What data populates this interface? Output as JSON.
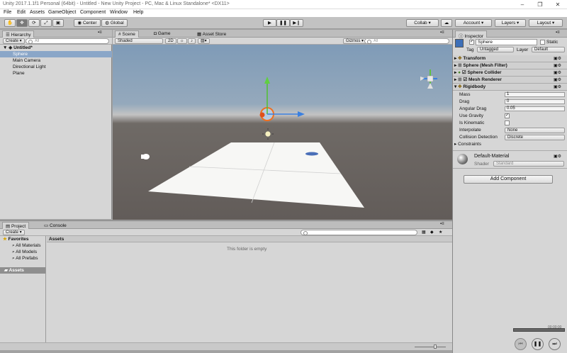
{
  "window": {
    "title": "Unity 2017.1.1f1 Personal (64bit) - Untitled - New Unity Project - PC, Mac & Linux Standalone* <DX11>",
    "min": "–",
    "max": "❐",
    "close": "✕"
  },
  "menu": [
    "File",
    "Edit",
    "Assets",
    "GameObject",
    "Component",
    "Window",
    "Help"
  ],
  "toolbar": {
    "center": "Center",
    "global": "Global",
    "collab": "Collab ▾",
    "account": "Account ▾",
    "layers": "Layers ▾",
    "layout": "Layout ▾",
    "play": "▶",
    "pause": "❚❚",
    "step": "▶❙"
  },
  "hierarchy": {
    "tab": "Hierarchy",
    "create": "Create ▾",
    "search": "All",
    "scene": "Untitled*",
    "items": [
      "Sphere",
      "Main Camera",
      "Directional Light",
      "Plane"
    ]
  },
  "scene": {
    "tabs": [
      "Scene",
      "Game",
      "Asset Store"
    ],
    "shading": "Shaded",
    "mode2d": "2D",
    "gizmos": "Gizmos ▾",
    "search": "All"
  },
  "project": {
    "tabs": [
      "Project",
      "Console"
    ],
    "create": "Create ▾",
    "favorites": "Favorites",
    "fav_items": [
      "All Materials",
      "All Models",
      "All Prefabs"
    ],
    "assets_root": "Assets",
    "crumb": "Assets",
    "empty": "This folder is empty"
  },
  "inspector": {
    "tab": "Inspector",
    "object_name": "Sphere",
    "static": "Static",
    "tag_label": "Tag",
    "tag": "Untagged",
    "layer_label": "Layer",
    "layer": "Default",
    "components": [
      "Transform",
      "Sphere (Mesh Filter)",
      "Sphere Collider",
      "Mesh Renderer",
      "Rigidbody"
    ],
    "props": [
      {
        "label": "Mass",
        "value": "1"
      },
      {
        "label": "Drag",
        "value": "0"
      },
      {
        "label": "Angular Drag",
        "value": "0.05"
      }
    ],
    "use_gravity": "Use Gravity",
    "is_kinematic": "Is Kinematic",
    "interpolate_label": "Interpolate",
    "interpolate": "None",
    "collision_label": "Collision Detection",
    "collision": "Discrete",
    "constraints": "Constraints",
    "material": "Default-Material",
    "shader_label": "Shader",
    "shader": "Standard",
    "add_component": "Add Component"
  },
  "player": {
    "time": "00:00:00"
  },
  "colors": {
    "accent": "#3f7bd0",
    "sel": "#8aa6c8",
    "sky": "#7f9bb7"
  }
}
